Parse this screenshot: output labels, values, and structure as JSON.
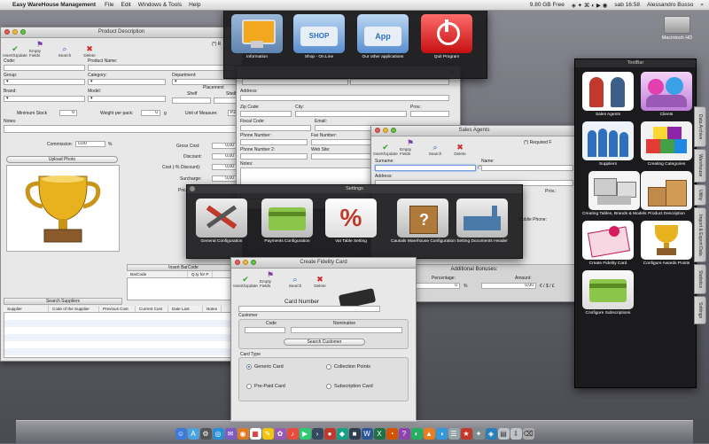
{
  "menubar": {
    "apple": "",
    "app_name": "Easy WareHouse Management",
    "menus": [
      "File",
      "Edit",
      "Windows & Tools",
      "Help"
    ],
    "free_space": "9.80 GB Free",
    "clock": "sab 16:58",
    "user": "Alessandro Busso"
  },
  "desktop": {
    "hd_label": "Macintosh HD"
  },
  "product_window": {
    "title": "Product Description",
    "toolbar": [
      "Insert/Update",
      "Empty Fields",
      "Search",
      "Delete"
    ],
    "required_note": "(*) R",
    "labels": {
      "code": "Code:",
      "product_name": "Product Name:",
      "group": "Group:",
      "category": "Category:",
      "department": "Department:",
      "brand": "Brand:",
      "model": "Model:",
      "placement": "Placement",
      "shelf": "Shelf",
      "shelf2": "Shelf",
      "minimum_stock": "Minimum Stock",
      "weight_per_pack": "Weight per pack:",
      "unit_of_measure": "Unit of Measure:",
      "notes": "Notes:",
      "commission": "Commission:",
      "gross_cost": "Gross Cost:",
      "discount": "Discount:",
      "cost_discount": "Cost (-% Discount):",
      "surcharge": "Surcharge:",
      "price": "Price",
      "upload_photo": "Upload Photo",
      "insert_barcode": "Insert BarCode",
      "barcode_col": "BarCode",
      "qty_col": "Q.ty for P",
      "search_suppliers": "Search Suppliers"
    },
    "values": {
      "minimum_stock": "0",
      "weight": "0",
      "weight_unit": "g",
      "unit": "PZ",
      "commission": "0,00",
      "commission_unit": "%",
      "gross_cost": "0,00",
      "discount": "0,00",
      "cost_discount": "0,00",
      "surcharge": "0,00",
      "price": "0,00"
    },
    "supplier_columns": [
      "Supplier",
      "Code of the Supplier",
      "Previous Cost",
      "Current Cost",
      "Date Last Load",
      "Notes"
    ]
  },
  "client_window": {
    "required": "(*)",
    "labels": {
      "address": "Address:",
      "zip": "Zip Code:",
      "city": "City:",
      "prov": "Prov.:",
      "fiscal_code": "Fiscal Code:",
      "email": "Email:",
      "phone1": "Phone Number:",
      "fax": "Fax Number:",
      "phone2": "Phone Number 2:",
      "website": "Web Site:",
      "notes": "Notes:"
    }
  },
  "launcher": {
    "items": [
      {
        "label": "Information"
      },
      {
        "label": "Shop - On.Line",
        "art": "SHOP"
      },
      {
        "label": "Our other applications",
        "art": "App"
      },
      {
        "label": "Quit Program"
      }
    ]
  },
  "sales_agents": {
    "title": "Sales Agents",
    "toolbar": [
      "Insert/Update",
      "Empty Fields",
      "Search",
      "Delete"
    ],
    "required_note": "(*) Required F",
    "labels": {
      "surname": "Surname:",
      "name": "Name:",
      "address": "Address:",
      "prov": "Prov.:",
      "mobile": "Mobile Phone:",
      "additional_bonuses": "Additional Bonuses:",
      "percentage": "Percentage:",
      "amount": "Amount:"
    },
    "values": {
      "percentage": "0",
      "pct_unit": "%",
      "amount": "0,00",
      "currency": "€ / $ / £",
      "req": "(*)"
    }
  },
  "settings": {
    "title": "Settings",
    "items": [
      {
        "label": "General Configuration"
      },
      {
        "label": "Payments Configuration"
      },
      {
        "label": "Vat Table Setting"
      },
      {
        "label": "Causals Warehouse Configuration"
      },
      {
        "label": "Setting Documents Header"
      }
    ]
  },
  "fidelity": {
    "title": "Create Fidelity Card",
    "toolbar": [
      "Insert/Update",
      "Empty Fields",
      "Search",
      "Delete"
    ],
    "card_number": "Card Number",
    "customer": "Customer",
    "code": "Code",
    "nominative": "Nominative",
    "search_customer": "Search Customer",
    "card_type": "Card Type",
    "types": [
      {
        "label": "Generic Card",
        "selected": true
      },
      {
        "label": "Collection Points",
        "selected": false
      },
      {
        "label": "Pre-Paid Card",
        "selected": false
      },
      {
        "label": "Subscription Card",
        "selected": false
      }
    ]
  },
  "toolbox": {
    "title": "ToolBar",
    "items": [
      {
        "label": "Sales Agents"
      },
      {
        "label": "Clients"
      },
      {
        "label": "Suppliers"
      },
      {
        "label": "Creating Categories"
      },
      {
        "label": "Creating Tables, Brands & Models"
      },
      {
        "label": "Product Description"
      },
      {
        "label": "Create Fidelity Card"
      },
      {
        "label": "Configure Awards Points"
      },
      {
        "label": "Configure Subscriptions"
      }
    ],
    "tabs": [
      "Data Archive",
      "Warehouse",
      "Utility",
      "Import & Export Data",
      "Statistics",
      "Settings"
    ]
  },
  "colors": {
    "accent_green": "#33a02c",
    "delete_red": "#d0282b",
    "radio_blue": "#2d64d8"
  }
}
